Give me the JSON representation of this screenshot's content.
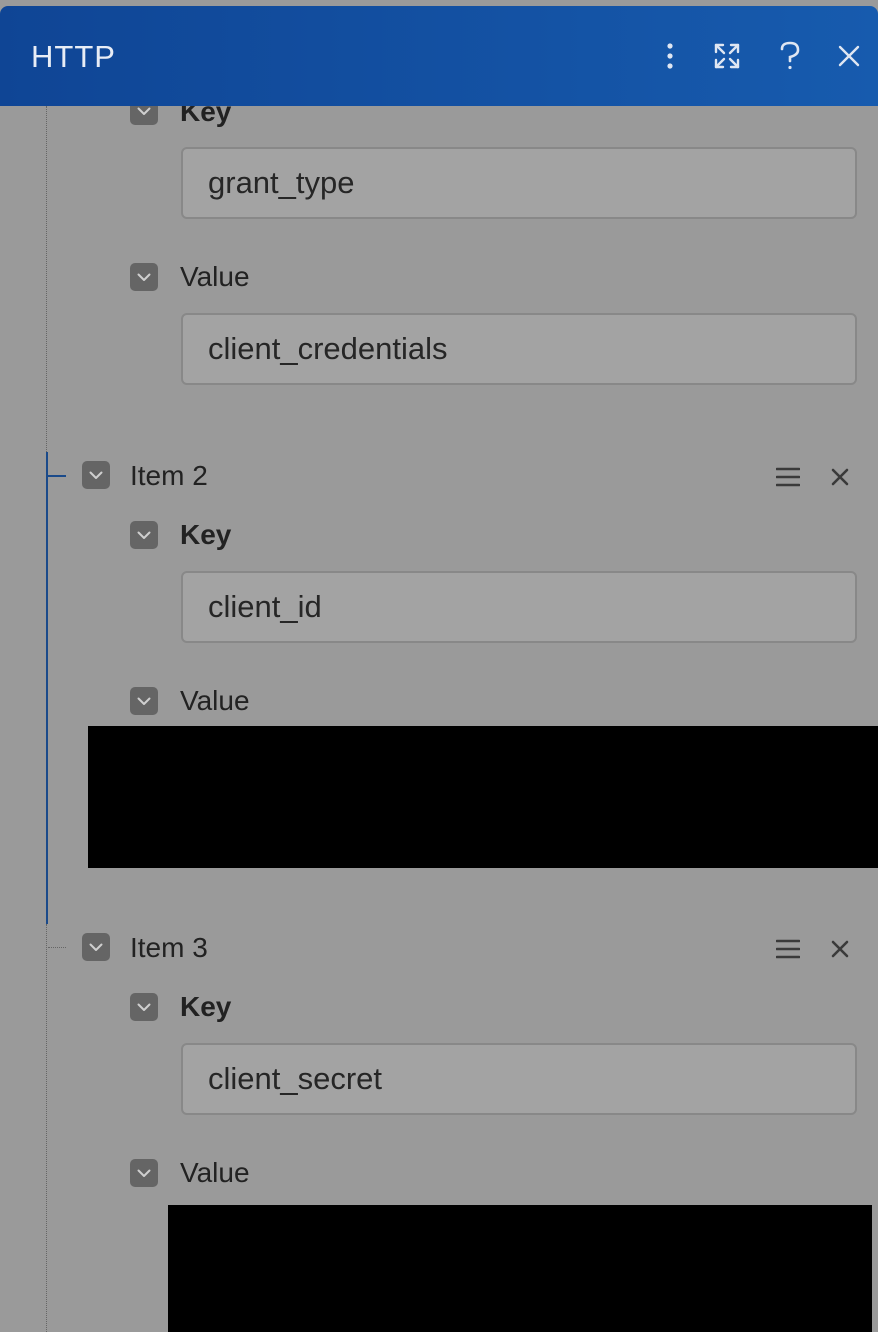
{
  "window": {
    "title": "HTTP"
  },
  "header_icons": [
    "kebab-menu-icon",
    "expand-icon",
    "help-icon",
    "close-icon"
  ],
  "item1": {
    "key_label": "Key",
    "key_value": "grant_type",
    "value_label": "Value",
    "value_value": "client_credentials"
  },
  "item2": {
    "title": "Item 2",
    "key_label": "Key",
    "key_value": "client_id",
    "value_label": "Value"
  },
  "item3": {
    "title": "Item 3",
    "key_label": "Key",
    "key_value": "client_secret",
    "value_label": "Value"
  },
  "colors": {
    "header": "#1254a3",
    "overlay": "#9a9a9a",
    "tree_line_active": "#1a4a8a"
  }
}
